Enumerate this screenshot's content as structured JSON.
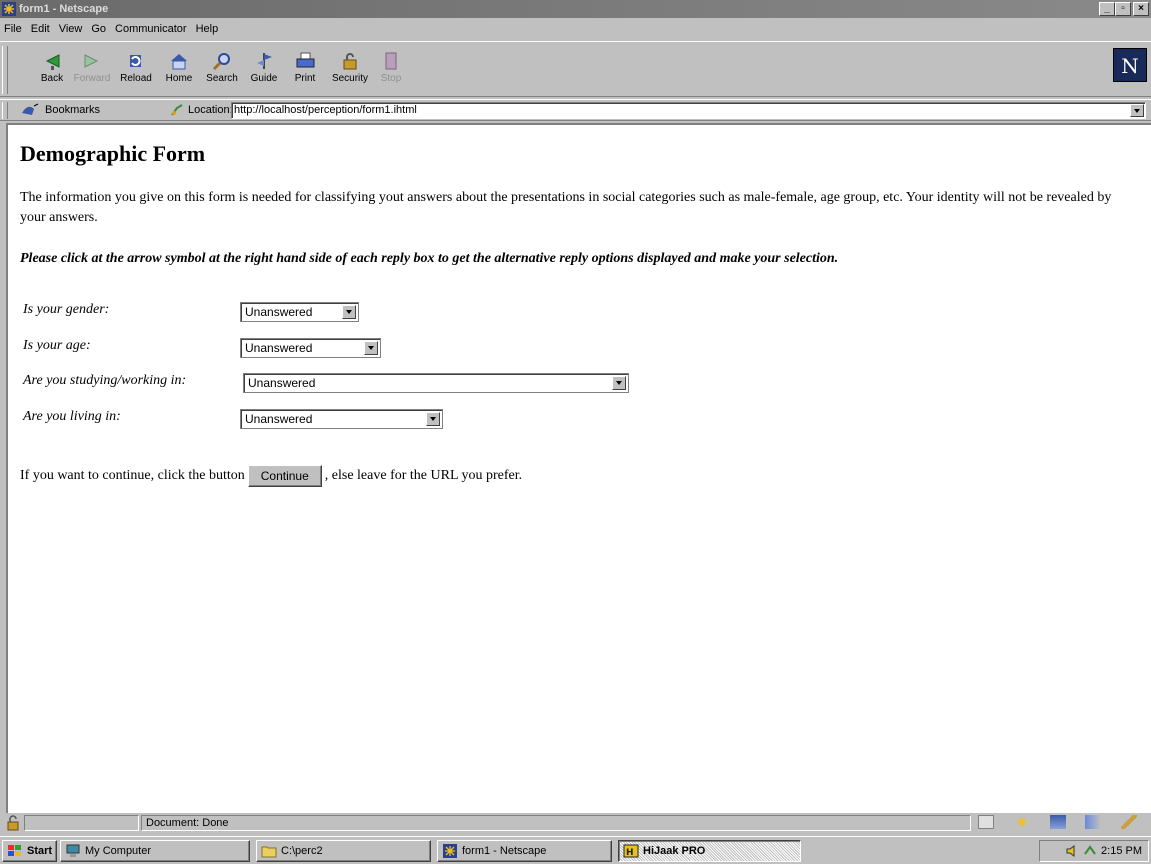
{
  "window": {
    "title": "form1 - Netscape",
    "min": "_",
    "max": "▫",
    "close": "×"
  },
  "menu": [
    "File",
    "Edit",
    "View",
    "Go",
    "Communicator",
    "Help"
  ],
  "toolbar": [
    {
      "label": "Back",
      "icon": "back-icon",
      "enabled": true
    },
    {
      "label": "Forward",
      "icon": "forward-icon",
      "enabled": false
    },
    {
      "label": "Reload",
      "icon": "reload-icon",
      "enabled": true
    },
    {
      "label": "Home",
      "icon": "home-icon",
      "enabled": true
    },
    {
      "label": "Search",
      "icon": "search-icon",
      "enabled": true
    },
    {
      "label": "Guide",
      "icon": "guide-icon",
      "enabled": true
    },
    {
      "label": "Print",
      "icon": "print-icon",
      "enabled": true
    },
    {
      "label": "Security",
      "icon": "security-icon",
      "enabled": true
    },
    {
      "label": "Stop",
      "icon": "stop-icon",
      "enabled": false
    }
  ],
  "logo": "N",
  "location": {
    "bookmarks_label": "Bookmarks",
    "location_label": "Location:",
    "url": "http://localhost/perception/form1.ihtml"
  },
  "page": {
    "title": "Demographic Form",
    "intro": "The information you give on this form is needed for classifying yout answers about the presentations in social categories such as male-female, age group, etc. Your identity will not be revealed by your answers.",
    "instruction": "Please click at the arrow symbol at the right hand side of each reply box to get the alternative reply options displayed and make your selection.",
    "questions": [
      {
        "label": "Is your gender:",
        "value": "Unanswered"
      },
      {
        "label": "Is your age:",
        "value": "Unanswered"
      },
      {
        "label": "Are you studying/working in:",
        "value": "Unanswered"
      },
      {
        "label": "Are you living in:",
        "value": "Unanswered"
      }
    ],
    "continue_before": "If you want to continue, click the button",
    "continue_button": "Continue",
    "continue_after": ", else leave for the URL you prefer."
  },
  "status": {
    "text": "Document: Done"
  },
  "taskbar": {
    "start": "Start",
    "items": [
      "My Computer",
      "C:\\perc2",
      "form1 - Netscape",
      "HiJaak PRO"
    ],
    "clock": "2:15 PM"
  }
}
